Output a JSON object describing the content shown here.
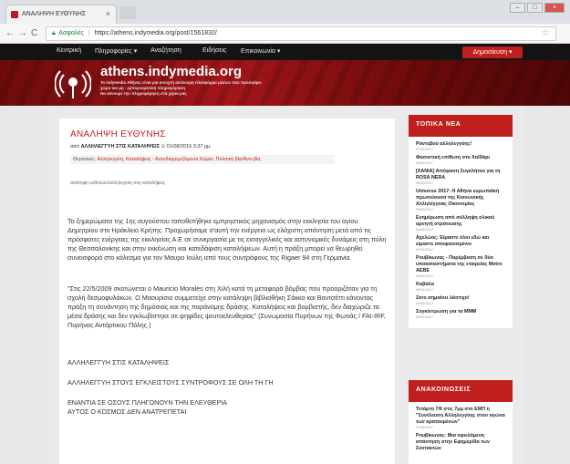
{
  "browser": {
    "tab_title": "ΑΝΑΛΗΨΗ ΕΥΘΥΝΗΣ",
    "tab_close": "×",
    "secure_label": "Ασφαλές",
    "url": "https://athens.indymedia.org/post/1561832/"
  },
  "sitenav": {
    "items": [
      "Κεντρική",
      "Πληροφορίες ▾",
      "Αναζήτηση",
      "Ειδήσεις",
      "Επικοινωνία ▾"
    ],
    "publish_label": "Δημοσίευση ▾"
  },
  "banner": {
    "title": "athens.indymedia.org",
    "tagline_1": "Το indymedia Αθήνας είναι μια ανοιχτή αυτόνομη πλατφόρμα μέσων που προσφέρει",
    "tagline_2": "χώρο και μη - εμπορευματική πληροφόρηση",
    "tagline_3": "Να κάνουμε την πληροφόρηση στα χέρια μας"
  },
  "article": {
    "title": "ΑΝΑΛΗΨΗ ΕΥΘΥΝΗΣ",
    "byline_prefix": "από",
    "author": "ΑΛΛΗΛΕΓΓΥΗ ΣΤΙΣ ΚΑΤΑΛΗΨΕΙΣ",
    "date": "01/08/2016 3:37 μμ.",
    "categories_label": "Θεματικές:",
    "categories": "Αλληλεγγύη, Καταλήψεις - Αυτοδιαχειριζόμενοι Χώροι, Πολιτική βία/Αντι-βία,",
    "tags": "ανάληψη ευθυνών/αλληλεγγύη στις καταλήψεις",
    "p1": "Τα ξημερώματα της 1ης αυγούστου τοποθετήθηκε εμπρηστικός μηχανισμός στην εκκλησία του αγίου Δημητρίου στο Ηράκλειο Κρήτης. Προχωρήσαμε σ'αυτή την ενέργεια ως ελάχιστη απάντηση μετά από τις πρόσφατες ενέργειες της εκκλησίας Α.Ε σε συνεργασία με τις εισαγγελικές και αστυνομικές δυνάμεις στη πόλη της Θεσσαλονίκης και στην εκκένωση και κατεδάφιση καταλήψεων. Αυτή η πράξη μπορεί να θεωρηθεί συνεισφορά στο κάλεσμα για τον Μαυρο Ιούλη από τους συντρόφους της Rigaer 94 στη Γερμανία.",
    "p2": "\"Στις 22/5/2009 σκοτώνεται ο Mauricio Morales στη Χιλή κατά τη μεταφορά βόμβας που προοριζόταν για τη σχολή δεσμοφυλάκων. Ο Μαουρίσιο συμμετείχε στην κατάληψη βιβλιοθήκη Σάκκο και Βαντσέττι κάνοντας πράξη τη συνάντηση της δημόσιας και της παράνομης δράσης. Καταλήψεις και βομβιστής, δεν διαχώριζε τα μέσα δράσης και δεν εγκλωβίστηκε σε ψηφίδες ψευτοελευθερίας\" (Συνωμοσία Πυρήνων της Φωτιάς / FAI-IRF, Πυρήνας Αντάρτικου Πόλης )",
    "p3": "ΑΛΛΗΛΕΓΓΥΗ ΣΤΙΣ ΚΑΤΑΛΗΨΕΙΣ",
    "p4": "ΑΛΛΗΛΕΓΓΥΗ ΣΤΟΥΣ ΕΓΚΛΕΙΣΤΟΥΣ ΣΥΝΤΡΟΦΟΥΣ ΣΕ ΟΛΗ ΤΗ ΓΗ",
    "p5": "ΕΝΑΝΤΙΑ ΣΕ ΟΣΟΥΣ ΠΛΗΓΩΝΟΥΝ ΤΗΝ ΕΛΕΥΘΕΡΙΑ",
    "p6": "ΑΥΤΟΣ Ο ΚΟΣΜΟΣ ΔΕΝ ΑΝΑΤΡΕΠΕΤΑΙ"
  },
  "sidebar": {
    "news_heading": "ΤΟΠΙΚΑ ΝΕΑ",
    "news": [
      {
        "title": "Ραντεβού αλληλεγγύης!",
        "date": "07/06/2017"
      },
      {
        "title": "Φασιστική επίθεση στο Χαϊδάρι",
        "date": "06/06/2017"
      },
      {
        "title": "[ΧΑΝΙΑ] Απόφαση Συγκλήτου για τη ROSA NERA",
        "date": "06/06/2017"
      },
      {
        "title": "Universe 2017: Η Αθήνα ευρωπαϊκή πρωτεύουσα της Κοινωνικής Αλληλέγγυας Οικονομίας",
        "date": "06/06/2017"
      },
      {
        "title": "Ενημέρωση από σύλληψη ολικού αρνητή στράτευσης",
        "date": "06/06/2017"
      },
      {
        "title": "Αχελώος: Είμαστε όλοι εδώ και είμαστε αποφασισμένοι",
        "date": "06/06/2017"
      },
      {
        "title": "Ρουβίκωνας - Παρέμβαση σε δύο υποκαταστήματα της εταιρείας Metro ΑΕΒΕ",
        "date": "06/06/2017"
      },
      {
        "title": "Καβάλα",
        "date": "06/06/2017"
      },
      {
        "title": "Zero σημαίνει λάστιχο!",
        "date": "06/06/2017"
      },
      {
        "title": "Συγκέντρωση για τα ΜΜΜ",
        "date": "06/06/2017"
      }
    ],
    "announce_heading": "ΑΝΑΚΟΙΝΩΣΕΙΣ",
    "announcements": [
      {
        "title": "Τετάρτη 7/6 στις 7μμ στο ΕΜΠ η \"Συνέλευση Αλληλεγγύης στον αγώνα των κρατουμένων\"",
        "date": "07/06/2017"
      },
      {
        "title": "Ρουβίκωνας: Μια οφειλόμενη απάντηση στην Εφημερίδα των Συντακτών",
        "date": ""
      }
    ]
  }
}
